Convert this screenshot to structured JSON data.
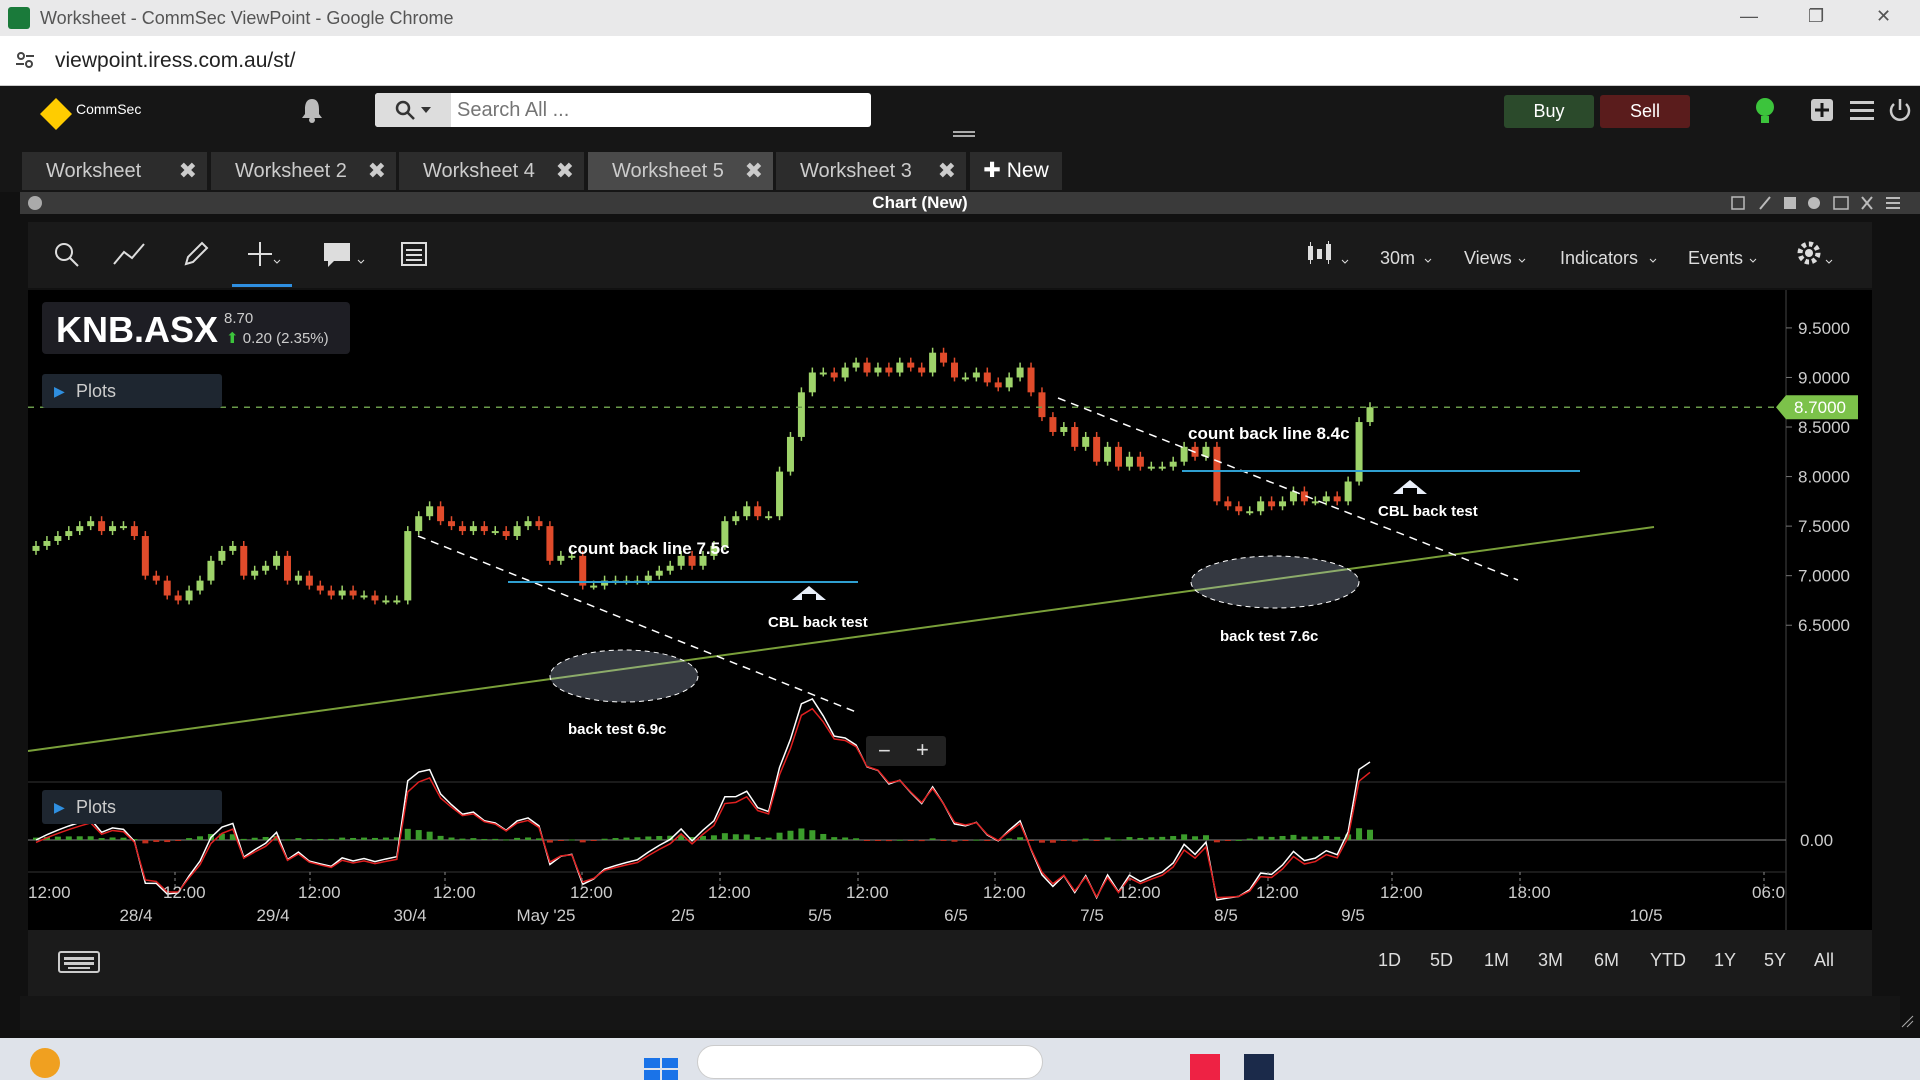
{
  "window": {
    "title": "Worksheet - CommSec ViewPoint - Google Chrome",
    "url": "viewpoint.iress.com.au/st/"
  },
  "header": {
    "brand": "CommSec",
    "search_placeholder": "Search All ...",
    "buy_label": "Buy",
    "sell_label": "Sell"
  },
  "tabs": [
    {
      "label": "Worksheet",
      "active": false
    },
    {
      "label": "Worksheet 2",
      "active": false
    },
    {
      "label": "Worksheet 4",
      "active": false
    },
    {
      "label": "Worksheet 5",
      "active": true
    },
    {
      "label": "Worksheet 3",
      "active": false
    }
  ],
  "new_tab_label": "New",
  "panel_title": "Chart (New)",
  "toolbar": {
    "interval": "30m",
    "views": "Views",
    "indicators": "Indicators",
    "events": "Events"
  },
  "symbol": {
    "code": "KNB.ASX",
    "price": "8.70",
    "change": "0.20 (2.35%)"
  },
  "plots_label": "Plots",
  "ranges": [
    "1D",
    "5D",
    "1M",
    "3M",
    "6M",
    "YTD",
    "1Y",
    "5Y",
    "All"
  ],
  "chart_data": {
    "type": "candlestick",
    "interval": "30m",
    "y_ticks": [
      "9.5000",
      "9.0000",
      "8.5000",
      "8.0000",
      "7.5000",
      "7.0000",
      "6.5000"
    ],
    "ylim": [
      6.25,
      9.6
    ],
    "last_price_label": "8.7000",
    "last_price": 8.7,
    "time_labels_top": [
      "12:00",
      "12:00",
      "12:00",
      "12:00",
      "12:00",
      "12:00",
      "12:00",
      "12:00",
      "12:00",
      "12:00",
      "12:00",
      "18:00",
      "06:0"
    ],
    "time_labels_bottom": [
      "28/4",
      "29/4",
      "30/4",
      "May '25",
      "2/5",
      "5/5",
      "6/5",
      "7/5",
      "8/5",
      "9/5",
      "10/5"
    ],
    "annotations": [
      {
        "text": "count back line 7.5c"
      },
      {
        "text": "CBL back test"
      },
      {
        "text": "back test 6.9c"
      },
      {
        "text": "count back line 8.4c"
      },
      {
        "text": "CBL back test"
      },
      {
        "text": "back test 7.6c"
      }
    ],
    "closes": [
      7.3,
      7.35,
      7.4,
      7.45,
      7.5,
      7.55,
      7.45,
      7.5,
      7.5,
      7.4,
      7.0,
      6.95,
      6.8,
      6.75,
      6.85,
      6.95,
      7.15,
      7.25,
      7.3,
      7.0,
      7.05,
      7.1,
      7.2,
      6.95,
      7.0,
      6.9,
      6.85,
      6.8,
      6.85,
      6.8,
      6.8,
      6.75,
      6.75,
      6.75,
      7.45,
      7.6,
      7.7,
      7.55,
      7.5,
      7.45,
      7.5,
      7.45,
      7.45,
      7.4,
      7.5,
      7.55,
      7.5,
      7.15,
      7.2,
      7.2,
      6.9,
      6.9,
      6.95,
      6.95,
      6.95,
      6.95,
      7.0,
      7.05,
      7.1,
      7.2,
      7.1,
      7.2,
      7.3,
      7.55,
      7.6,
      7.7,
      7.6,
      7.6,
      8.05,
      8.4,
      8.85,
      9.05,
      9.05,
      9.0,
      9.1,
      9.15,
      9.05,
      9.1,
      9.05,
      9.15,
      9.1,
      9.05,
      9.25,
      9.15,
      9.0,
      9.0,
      9.05,
      8.95,
      8.9,
      9.0,
      9.1,
      8.85,
      8.6,
      8.45,
      8.5,
      8.3,
      8.4,
      8.15,
      8.3,
      8.1,
      8.2,
      8.1,
      8.1,
      8.1,
      8.15,
      8.3,
      8.2,
      8.3,
      7.75,
      7.7,
      7.65,
      7.65,
      7.75,
      7.7,
      7.75,
      7.85,
      7.75,
      7.75,
      7.8,
      7.75,
      7.95,
      8.55,
      8.7
    ],
    "macd": {
      "zero_label": "0.00"
    }
  }
}
